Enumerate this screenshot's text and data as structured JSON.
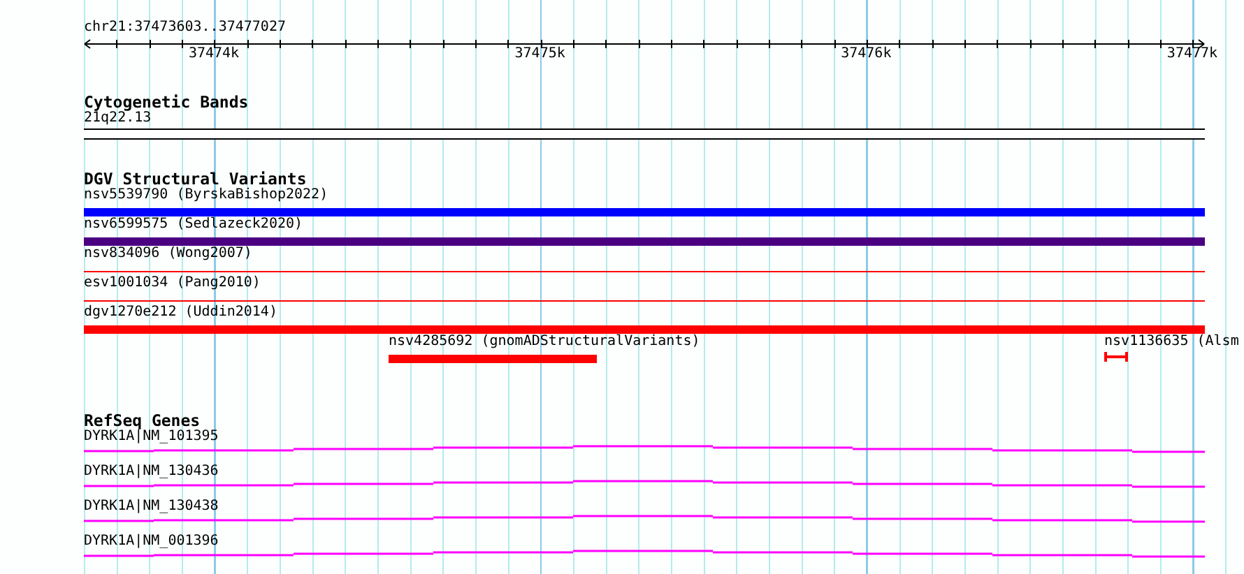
{
  "ruler": {
    "position": "chr21:37473603..37477027",
    "ticks": [
      "37474k",
      "37475k",
      "37476k",
      "37477k"
    ]
  },
  "cytogenetic_bands": {
    "title": "Cytogenetic Bands",
    "band": "21q22.13"
  },
  "dgv_structural_variants": {
    "title": "DGV Structural Variants",
    "features": [
      {
        "label": "nsv5539790 (ByrskaBishop2022)",
        "color": "#0000ff",
        "kind": "thick"
      },
      {
        "label": "nsv6599575 (Sedlazeck2020)",
        "color": "#4b0082",
        "kind": "thick"
      },
      {
        "label": "nsv834096 (Wong2007)",
        "color": "#ff0000",
        "kind": "thin"
      },
      {
        "label": "esv1001034 (Pang2010)",
        "color": "#ff0000",
        "kind": "thin"
      },
      {
        "label": "dgv1270e212 (Uddin2014)",
        "color": "#ff0000",
        "kind": "thick"
      },
      {
        "label": "nsv4285692 (gnomADStructuralVariants)",
        "color": "#ff0000",
        "kind": "thick"
      },
      {
        "label": "nsv1136635 (Alsm",
        "color": "#ff0000",
        "kind": "ibeam"
      }
    ]
  },
  "refseq_genes": {
    "title": "RefSeq Genes",
    "genes": [
      {
        "label": "DYRK1A|NM_101395"
      },
      {
        "label": "DYRK1A|NM_130436"
      },
      {
        "label": "DYRK1A|NM_130438"
      },
      {
        "label": "DYRK1A|NM_001396"
      }
    ]
  }
}
